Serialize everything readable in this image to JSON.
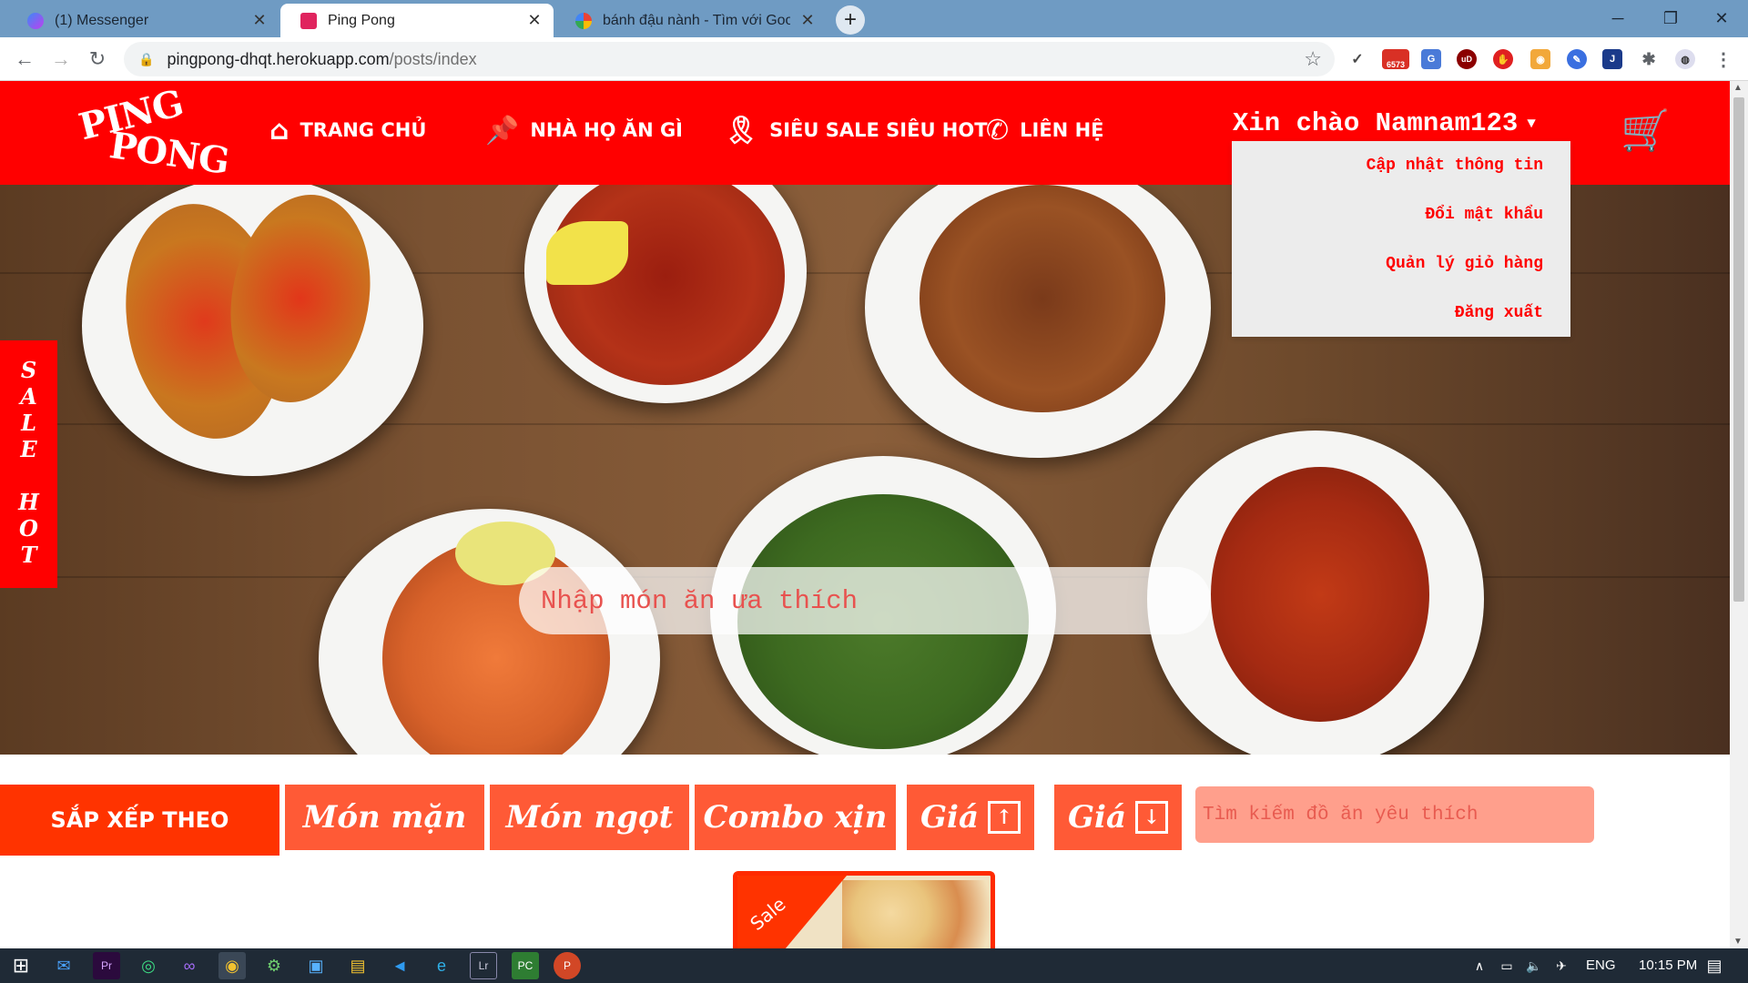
{
  "browser": {
    "tabs": [
      {
        "title": "(1) Messenger",
        "favicon": "messenger-icon",
        "active": false
      },
      {
        "title": "Ping Pong",
        "favicon": "heart-icon",
        "active": true
      },
      {
        "title": "bánh đậu nành - Tìm với Google",
        "favicon": "google-icon",
        "active": false
      }
    ],
    "url_host": "pingpong-dhqt.herokuapp.com",
    "url_path": "/posts/index",
    "ext_badge": "6573"
  },
  "header": {
    "logo_line1": "PING",
    "logo_line2": "PONG",
    "nav": [
      {
        "label": "TRANG CHỦ",
        "icon": "house-icon"
      },
      {
        "label": "NHÀ HỌ ĂN GÌ",
        "icon": "pin-icon"
      },
      {
        "label": "SIÊU SALE SIÊU HOT",
        "icon": "ribbon-icon"
      },
      {
        "label": "LIÊN HỆ",
        "icon": "phone-icon"
      }
    ],
    "greeting": "Xin chào Namnam123",
    "cart_icon": "cart-icon"
  },
  "user_menu": {
    "items": [
      "Cập nhật thông tin",
      "Đổi mật khẩu",
      "Quản lý giỏ hàng",
      "Đăng xuất"
    ]
  },
  "hero": {
    "search_placeholder": "Nhập món ăn ưa thích"
  },
  "sale_tab": {
    "word1": [
      "S",
      "A",
      "L",
      "E"
    ],
    "word2": [
      "H",
      "O",
      "T"
    ]
  },
  "sort": {
    "label": "SẮP XẾP THEO",
    "buttons": [
      "Món mặn",
      "Món ngọt",
      "Combo xịn",
      "Giá",
      "Giá"
    ],
    "search_placeholder": "Tìm kiếm đồ ăn yêu thích"
  },
  "card": {
    "ribbon": "Sale"
  },
  "taskbar": {
    "lang": "ENG",
    "time": "10:15 PM"
  },
  "colors": {
    "brand_red": "#ff0000",
    "sort_orange": "#ff5a36",
    "tab_strip": "#6f9bc3"
  }
}
